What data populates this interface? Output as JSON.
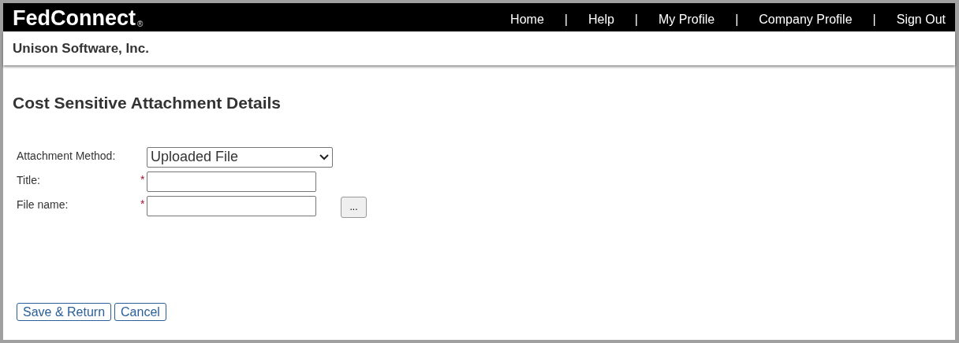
{
  "header": {
    "logo": "FedConnect",
    "logo_mark": "®",
    "nav": [
      {
        "label": "Home"
      },
      {
        "label": "Help"
      },
      {
        "label": "My Profile"
      },
      {
        "label": "Company Profile"
      },
      {
        "label": "Sign Out"
      }
    ],
    "separator": "|"
  },
  "company": "Unison Software, Inc.",
  "page_title": "Cost Sensitive Attachment Details",
  "form": [
    {
      "kind": "select",
      "label": "Attachment Method:",
      "value": "Uploaded File"
    },
    {
      "kind": "text",
      "label": "Title:",
      "required_mark": "*"
    },
    {
      "kind": "file",
      "label": "File name:",
      "required_mark": "*",
      "browse": "..."
    }
  ],
  "buttons": [
    "Save & Return",
    "Cancel"
  ]
}
